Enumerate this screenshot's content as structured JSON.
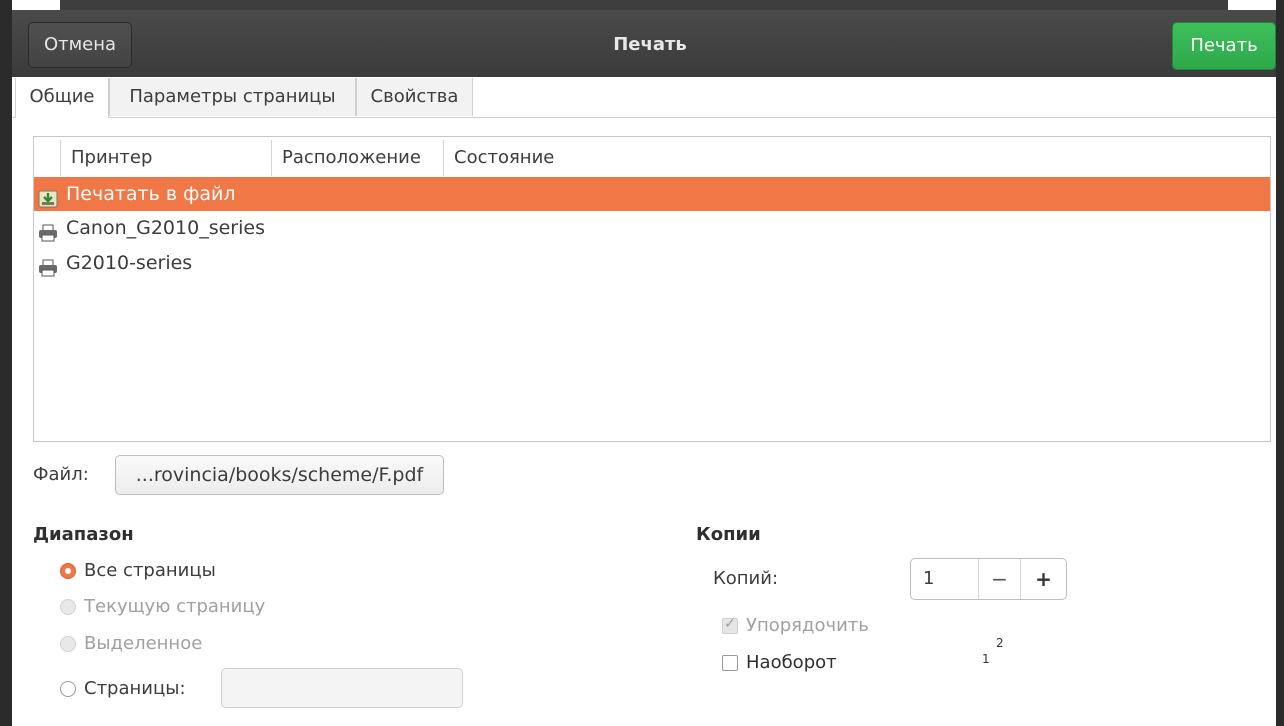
{
  "header": {
    "title": "Печать",
    "cancel_label": "Отмена",
    "print_label": "Печать"
  },
  "tabs": [
    {
      "label": "Общие",
      "active": true
    },
    {
      "label": "Параметры страницы",
      "active": false
    },
    {
      "label": "Свойства",
      "active": false
    }
  ],
  "printer_list": {
    "columns": [
      "Принтер",
      "Расположение",
      "Состояние"
    ],
    "rows": [
      {
        "name": "Печатать в файл",
        "icon": "save-to-file-icon",
        "selected": true
      },
      {
        "name": "Canon_G2010_series",
        "icon": "printer-icon",
        "selected": false
      },
      {
        "name": "G2010-series",
        "icon": "printer-icon",
        "selected": false
      }
    ]
  },
  "file": {
    "label": "Файл:",
    "path": "...rovincia/books/scheme/F.pdf"
  },
  "range": {
    "title": "Диапазон",
    "all_pages": "Все страницы",
    "current_page": "Текущую страницу",
    "selection": "Выделенное",
    "pages": "Страницы:",
    "pages_value": ""
  },
  "copies": {
    "title": "Копии",
    "label": "Копий:",
    "value": "1",
    "minus": "−",
    "plus": "+",
    "collate": "Упорядочить",
    "reverse": "Наоборот",
    "preview_1": "1",
    "preview_2": "2"
  },
  "colors": {
    "selection": "#f07746",
    "print_button": "#2ea84a",
    "header_bg": "#3b3b3b"
  }
}
